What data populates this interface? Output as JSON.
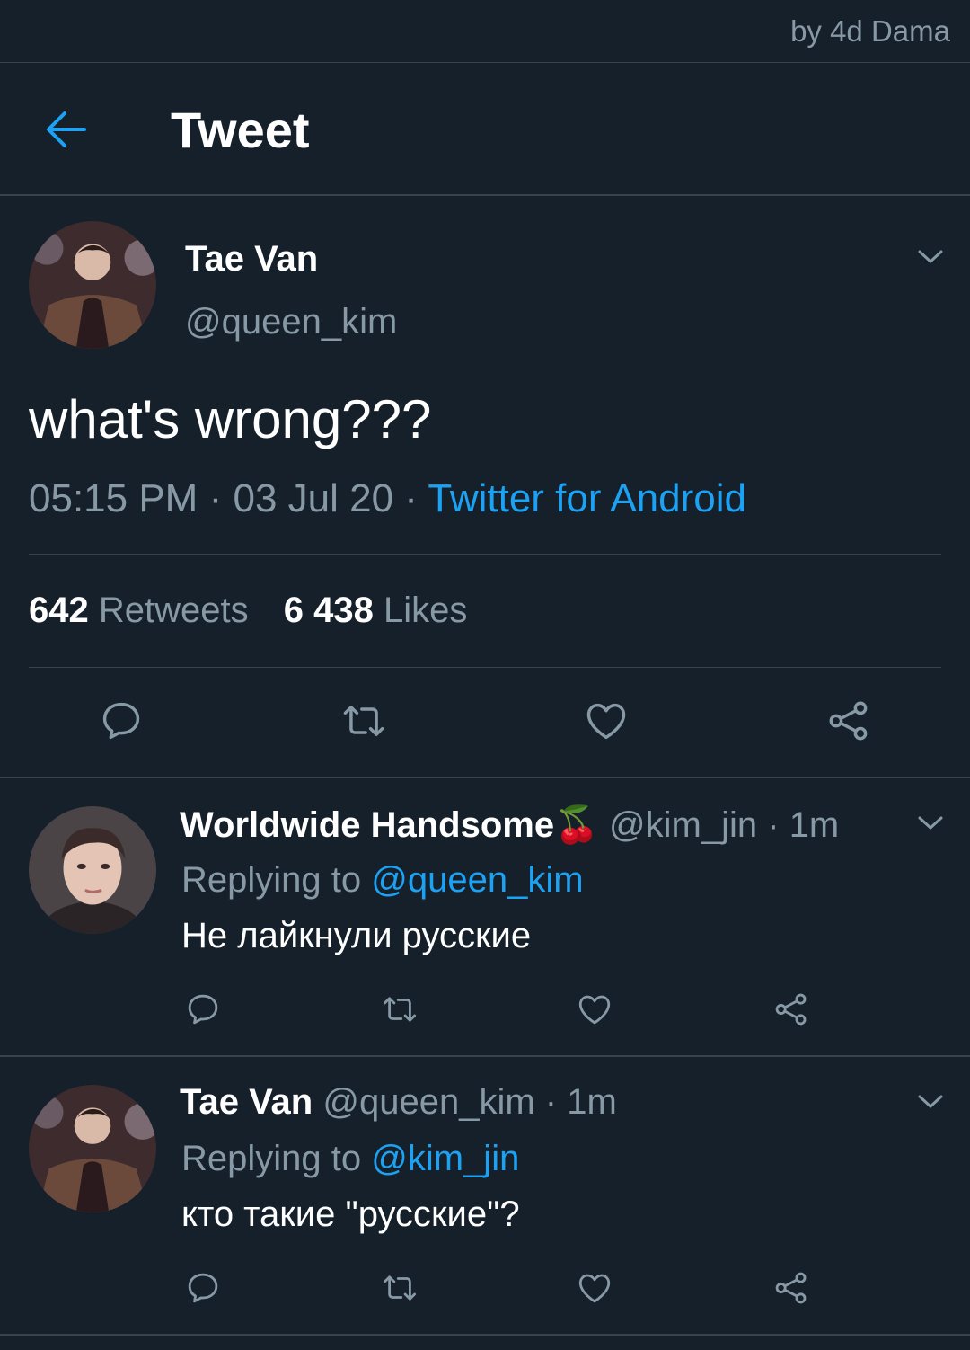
{
  "watermark": "by 4d Dama",
  "header": {
    "title": "Tweet"
  },
  "main_tweet": {
    "name": "Tae Van",
    "handle": "@queen_kim",
    "text": "what's wrong???",
    "time": "05:15 PM",
    "sep1": "·",
    "date": "03 Jul 20",
    "sep2": "·",
    "source": "Twitter for Android",
    "retweets_count": "642",
    "retweets_label": "Retweets",
    "likes_count": "6 438",
    "likes_label": "Likes"
  },
  "replies": [
    {
      "name": "Worldwide Handsome",
      "emoji": "🍒",
      "handle": "@kim_jin",
      "dot": "·",
      "time": "1m",
      "replying_label": "Replying to",
      "replying_to": "@queen_kim",
      "text": "Не лайкнули русские"
    },
    {
      "name": "Tae Van",
      "handle": "@queen_kim",
      "dot": "·",
      "time": "1m",
      "replying_label": "Replying to",
      "replying_to": "@kim_jin",
      "text": "кто такие \"русские\"?"
    }
  ],
  "colors": {
    "background": "#15202b",
    "divider": "#38444d",
    "muted": "#8899a6",
    "accent": "#1da1f2"
  },
  "icons": [
    "back-arrow-icon",
    "chevron-down-icon",
    "reply-icon",
    "retweet-icon",
    "like-icon",
    "share-icon"
  ]
}
